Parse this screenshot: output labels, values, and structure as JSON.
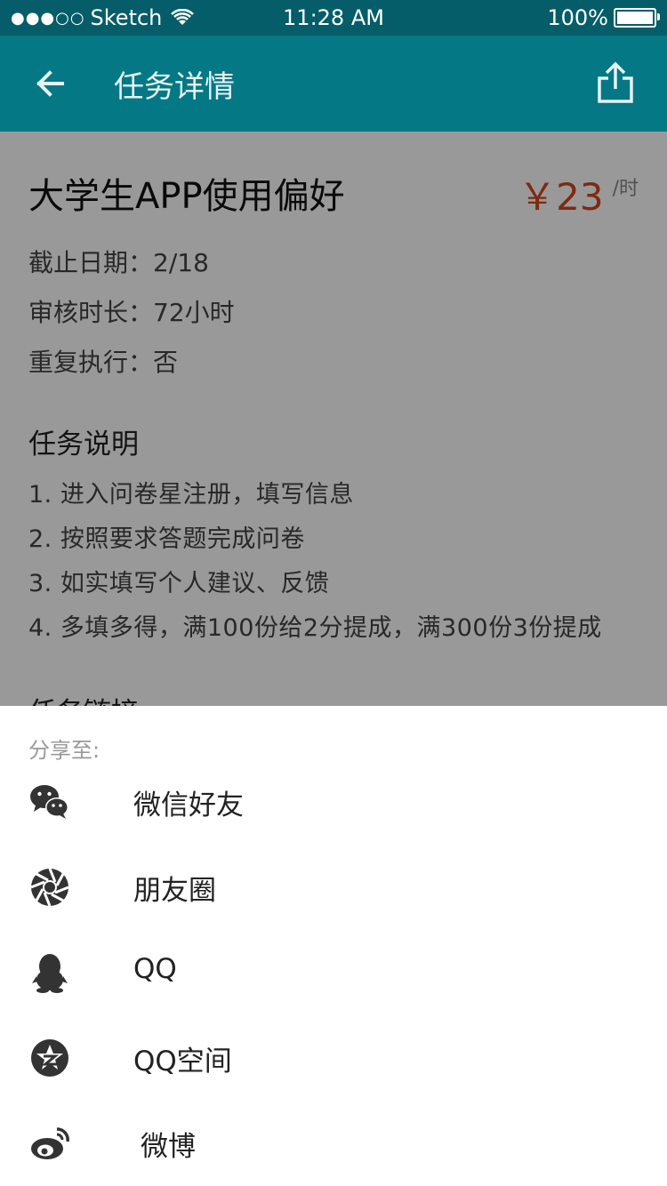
{
  "status_bar": {
    "signal_dots": "●●●○○",
    "carrier": "Sketch",
    "time": "11:28 AM",
    "battery_percent": "100%",
    "battery_level": 1.0
  },
  "navbar": {
    "title": "任务详情",
    "back_icon": "arrow-left-icon",
    "share_icon": "share-icon"
  },
  "task": {
    "title": "大学生APP使用偏好",
    "price": "￥23",
    "price_unit": "/时",
    "deadline": "截止日期：2/18",
    "review_time": "审核时长：72小时",
    "repeat": "重复执行：否",
    "section_description": "任务说明",
    "steps": [
      "1. 进入问卷星注册，填写信息",
      "2. 按照要求答题完成问卷",
      "3. 如实填写个人建议、反馈",
      "4. 多填多得，满100份给2分提成，满300份3份提成"
    ],
    "section_link": "任务链接"
  },
  "share_sheet": {
    "label": "分享至:",
    "items": [
      {
        "label": "微信好友",
        "icon": "wechat-icon"
      },
      {
        "label": "朋友圈",
        "icon": "moments-icon"
      },
      {
        "label": "QQ",
        "icon": "qq-icon"
      },
      {
        "label": "QQ空间",
        "icon": "qzone-icon"
      },
      {
        "label": "微博",
        "icon": "weibo-icon"
      }
    ]
  },
  "colors": {
    "status_bar_bg": "#045d68",
    "nav_bg": "#047885",
    "price": "#d0471e",
    "overlay": "rgba(0,0,0,0.4)"
  }
}
